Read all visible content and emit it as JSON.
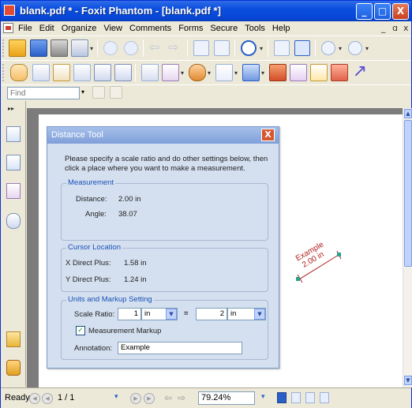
{
  "window": {
    "title": "blank.pdf * - Foxit Phantom - [blank.pdf *]",
    "minimize_glyph": "_",
    "maximize_glyph": "□",
    "close_glyph": "X"
  },
  "menu": {
    "items": [
      "File",
      "Edit",
      "Organize",
      "View",
      "Comments",
      "Forms",
      "Secure",
      "Tools",
      "Help"
    ],
    "mdi_minimize": "_",
    "mdi_restore": "ɑ",
    "mdi_close": "x"
  },
  "find": {
    "placeholder": "Find",
    "drop_glyph": "▾"
  },
  "dialog": {
    "title": "Distance Tool",
    "close_glyph": "X",
    "intro": "Please specify a scale ratio and do other settings below, then click a place where you want to make a measurement.",
    "measurement": {
      "legend": "Measurement",
      "distance_label": "Distance:",
      "distance_value": "2.00 in",
      "angle_label": "Angle:",
      "angle_value": "38.07"
    },
    "cursor": {
      "legend": "Cursor Location",
      "x_label": "X Direct Plus:",
      "x_value": "1.58 in",
      "y_label": "Y Direct Plus:",
      "y_value": "1.24 in"
    },
    "units": {
      "legend": "Units and Markup Setting",
      "scale_label": "Scale Ratio:",
      "scale_left_value": "1",
      "scale_left_unit": "in",
      "equals": "=",
      "scale_right_value": "2",
      "scale_right_unit": "in",
      "markup_checkbox_label": "Measurement Markup",
      "markup_checked": true,
      "check_glyph": "✓",
      "annotation_label": "Annotation:",
      "annotation_value": "Example"
    }
  },
  "markup_on_page": {
    "line1": "Example",
    "line2": "2.00 in",
    "color": "#b01f1f"
  },
  "status": {
    "ready": "Ready",
    "page": "1 / 1",
    "zoom": "79.24%",
    "drop_glyph": "▾"
  },
  "colors": {
    "titlebar": "#0a4ee0",
    "dialog_bg": "#d4e0f0",
    "accent_blue": "#1a4fb6",
    "markup_red": "#b01f1f"
  }
}
